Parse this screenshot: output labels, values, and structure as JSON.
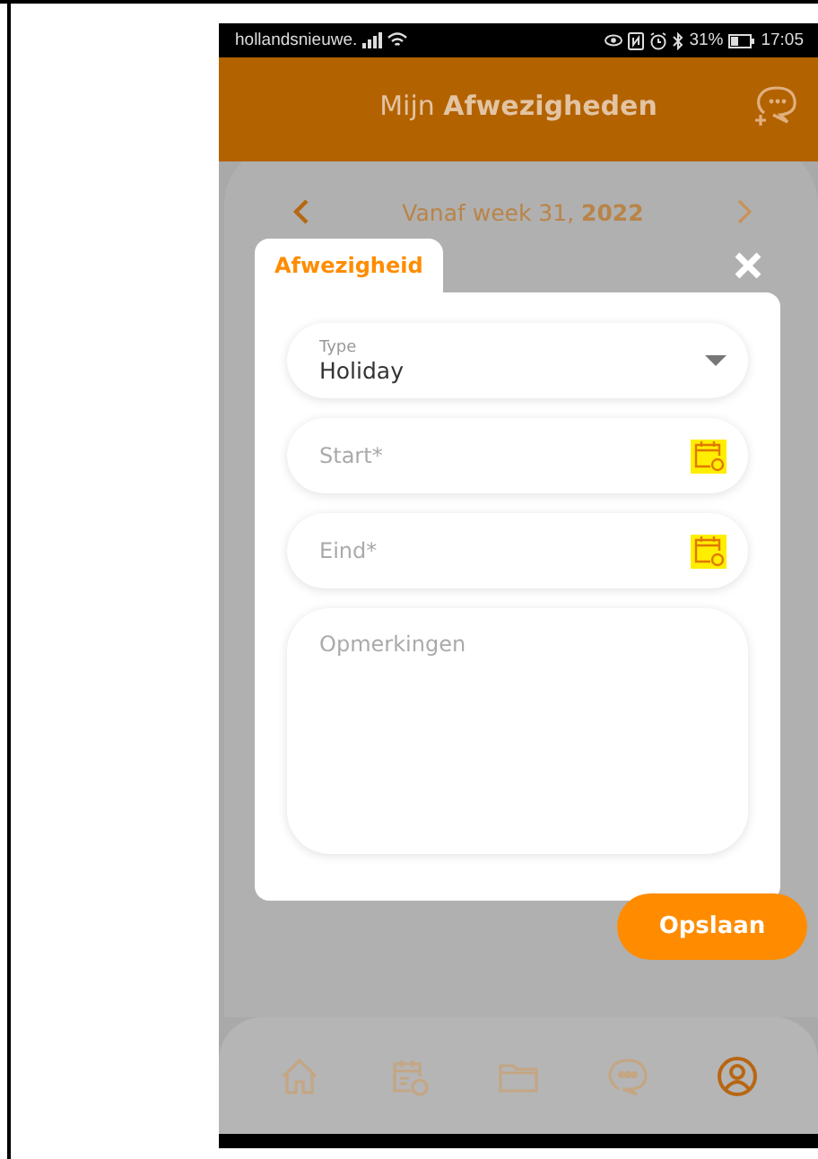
{
  "status_bar": {
    "carrier": "hollandsnieuwe.",
    "battery": "31%",
    "time": "17:05"
  },
  "header": {
    "title": "Mijn **Afwezigheden**"
  },
  "week_nav": {
    "label": "Vanaf week 31, **2022**"
  },
  "dialog": {
    "title": "Afwezigheid",
    "fields": [
      {
        "kind": "select",
        "label": "Type",
        "value": "Holiday"
      },
      {
        "kind": "date",
        "placeholder": "Start*"
      },
      {
        "kind": "date",
        "placeholder": "Eind*"
      },
      {
        "kind": "textarea",
        "placeholder": "Opmerkingen"
      }
    ],
    "save_button": "Opslaan"
  },
  "nav": [
    {
      "kind": "home",
      "selected": false
    },
    {
      "kind": "calendar",
      "selected": false
    },
    {
      "kind": "folder",
      "selected": false
    },
    {
      "kind": "chat",
      "selected": false
    },
    {
      "kind": "profile",
      "selected": true
    }
  ]
}
